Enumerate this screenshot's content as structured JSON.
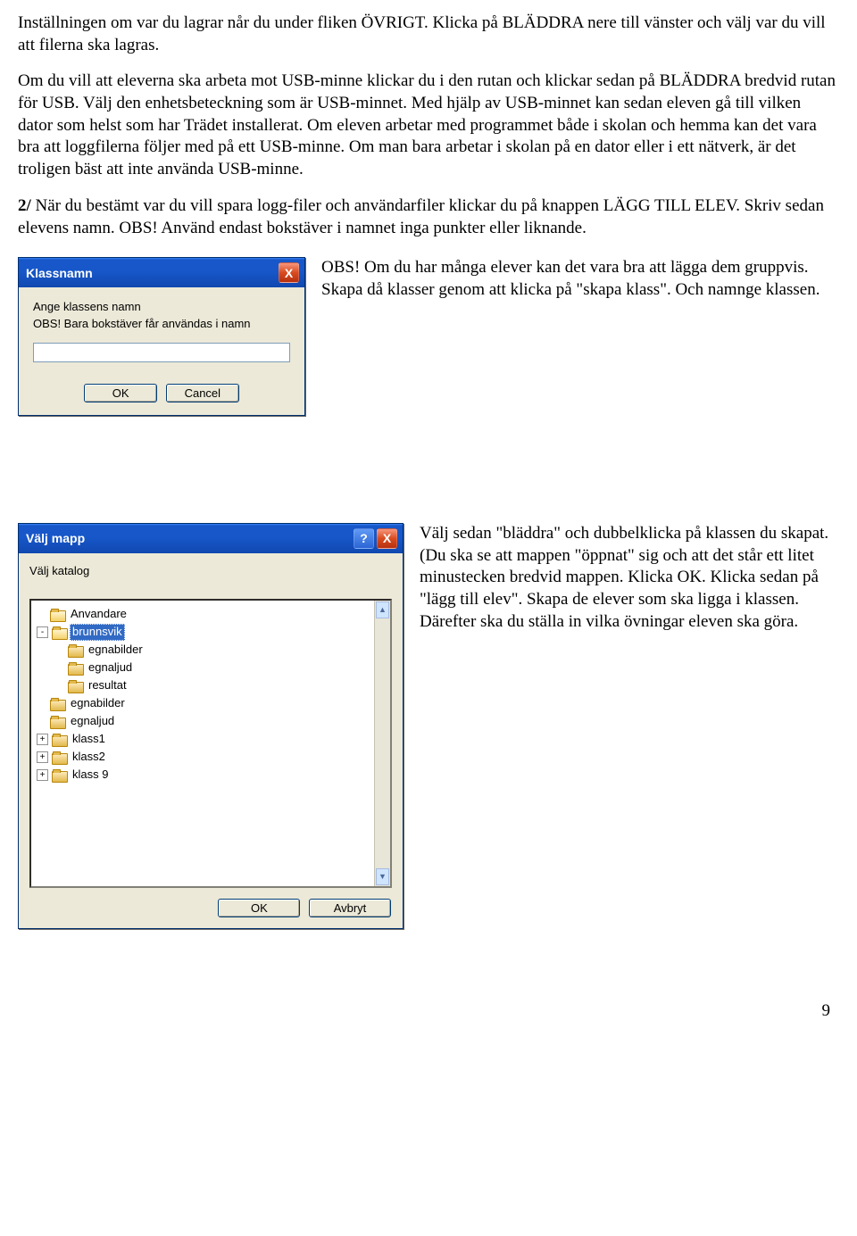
{
  "para1": "Inställningen om var du lagrar når du under fliken ÖVRIGT. Klicka på BLÄDDRA nere till vänster och välj var du vill att filerna ska lagras.",
  "para2": "Om du vill att eleverna ska arbeta mot USB-minne klickar du i den rutan och klickar sedan på BLÄDDRA  bredvid rutan för USB. Välj den enhetsbeteckning som är USB-minnet. Med hjälp av USB-minnet kan sedan eleven gå till vilken dator som helst som har Trädet installerat. Om eleven arbetar med programmet både i skolan och hemma kan det vara bra att loggfilerna följer med på ett USB-minne. Om man bara arbetar i skolan på en dator eller i ett nätverk, är det troligen bäst att inte använda USB-minne.",
  "para3": "2/ När du bestämt var du vill spara logg-filer och användarfiler klickar du på knappen LÄGG TILL ELEV. Skriv sedan elevens namn. OBS! Använd endast bokstäver i namnet inga punkter eller liknande.",
  "sideObs": "OBS! Om du har många elever kan det vara bra att lägga dem gruppvis. Skapa då klasser genom att klicka på \"skapa klass\". Och namnge klassen.",
  "sideMap": "Välj sedan \"bläddra\" och dubbelklicka på klassen du skapat. (Du ska se att mappen \"öppnat\" sig och att det står ett litet minustecken bredvid mappen. Klicka OK. Klicka sedan på \"lägg till elev\". Skapa de elever som ska ligga i klassen. Därefter ska du ställa in vilka övningar eleven ska göra.",
  "pageNumber": "9",
  "dlg1": {
    "title": "Klassnamn",
    "line1": "Ange klassens namn",
    "line2": "OBS! Bara bokstäver får användas i namn",
    "ok": "OK",
    "cancel": "Cancel",
    "close": "X"
  },
  "dlg2": {
    "title": "Välj mapp",
    "help": "?",
    "close": "X",
    "subtitle": "Välj katalog",
    "ok": "OK",
    "cancel": "Avbryt",
    "scrollUp": "▲",
    "scrollDown": "▼",
    "nodes": [
      {
        "indent": 1,
        "toggle": "",
        "label": "Anvandare",
        "open": true,
        "sel": false
      },
      {
        "indent": 1,
        "toggle": "-",
        "label": "brunnsvik",
        "open": true,
        "sel": true
      },
      {
        "indent": 2,
        "toggle": "",
        "label": "egnabilder",
        "open": false,
        "sel": false
      },
      {
        "indent": 2,
        "toggle": "",
        "label": "egnaljud",
        "open": false,
        "sel": false
      },
      {
        "indent": 2,
        "toggle": "",
        "label": "resultat",
        "open": false,
        "sel": false
      },
      {
        "indent": 1,
        "toggle": "",
        "label": "egnabilder",
        "open": false,
        "sel": false
      },
      {
        "indent": 1,
        "toggle": "",
        "label": "egnaljud",
        "open": false,
        "sel": false
      },
      {
        "indent": 1,
        "toggle": "+",
        "label": "klass1",
        "open": false,
        "sel": false
      },
      {
        "indent": 1,
        "toggle": "+",
        "label": "klass2",
        "open": false,
        "sel": false
      },
      {
        "indent": 1,
        "toggle": "+",
        "label": "klass 9",
        "open": false,
        "sel": false
      }
    ]
  }
}
